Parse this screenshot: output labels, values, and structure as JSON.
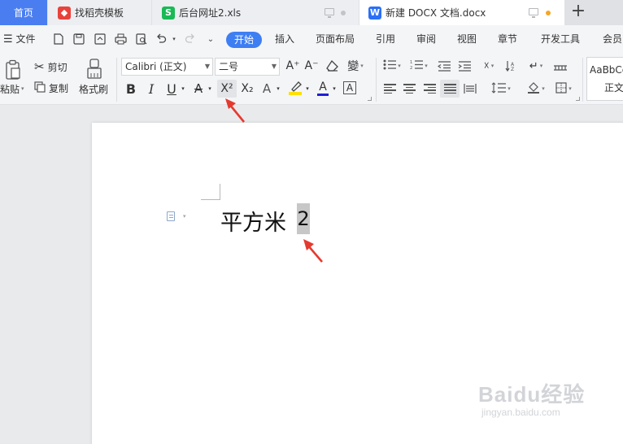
{
  "tabs": [
    {
      "label": "首页",
      "active": false
    },
    {
      "label": "找稻壳模板",
      "icon": "docer-icon"
    },
    {
      "label": "后台网址2.xls",
      "icon": "spreadsheet-icon"
    },
    {
      "label": "新建 DOCX 文档.docx",
      "icon": "writer-doc-icon",
      "active": true
    }
  ],
  "tab_icons": {
    "docer": "找",
    "sheet": "S",
    "writer": "W"
  },
  "new_tab_label": "+",
  "menu": {
    "file": "文件",
    "items": [
      "开始",
      "插入",
      "页面布局",
      "引用",
      "审阅",
      "视图",
      "章节",
      "开发工具",
      "会员"
    ]
  },
  "ribbon": {
    "clipboard": {
      "paste": "粘贴",
      "cut": "剪切",
      "copy": "复制",
      "format_painter": "格式刷"
    },
    "font_name": "Calibri (正文)",
    "font_size": "二号",
    "format_buttons": {
      "bold": "B",
      "italic": "I",
      "underline": "U",
      "strikethrough": "A",
      "superscript": "X²",
      "subscript": "X₂",
      "font_effect": "A",
      "font_color": "A",
      "char_border": "A"
    },
    "increase_font": "A⁺",
    "decrease_font": "A⁻",
    "style_preview": "AaBbCc",
    "style_name": "正文"
  },
  "document": {
    "text": "平方米",
    "selected_text": "2"
  },
  "watermark": {
    "brand": "Baidu经验",
    "url": "jingyan.baidu.com"
  },
  "colors": {
    "accent": "#3e7ef3",
    "tab_home": "#4a7ef0",
    "highlight": "#ffe000",
    "font_color": "#1f1fd6",
    "arrow": "#e53a2f",
    "dirty_dot": "#f5a623"
  }
}
